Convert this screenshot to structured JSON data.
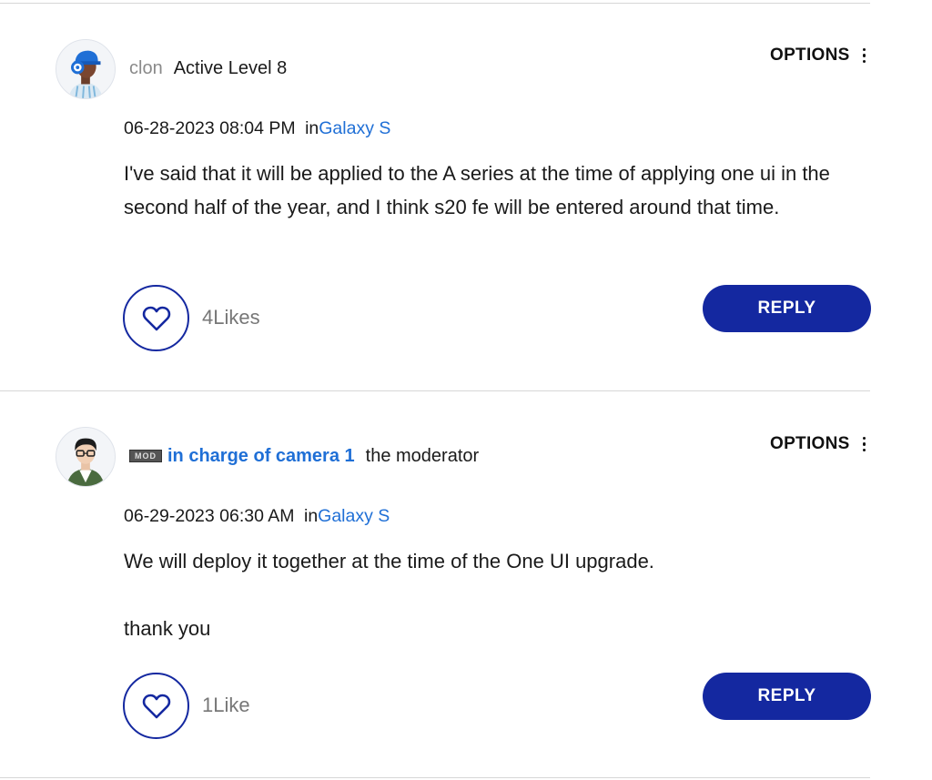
{
  "posts": [
    {
      "author": "clon",
      "rank": "Active Level 8",
      "is_moderator": false,
      "options_label": "OPTIONS",
      "date": "06-28-2023 08:04 PM",
      "in_label": "in",
      "board": "Galaxy S",
      "body": "I've said that it will be applied to the A series at the time of applying one ui in the second half of the year, and I think s20 fe will be entered around that time.",
      "likes": "4Likes",
      "reply_label": "REPLY"
    },
    {
      "mod_badge": "MOD",
      "author": "in charge of camera 1",
      "rank": "the moderator",
      "is_moderator": true,
      "options_label": "OPTIONS",
      "date": "06-29-2023 06:30 AM",
      "in_label": "in",
      "board": "Galaxy S",
      "body_lines": [
        "We will deploy it together at the time of the One UI upgrade.",
        "thank you"
      ],
      "likes": "1Like",
      "reply_label": "REPLY"
    }
  ],
  "colors": {
    "accent": "#1428a0",
    "link": "#1f6fd6",
    "divider": "#d6d6d6"
  },
  "icons": {
    "like": "heart-icon",
    "options": "kebab-menu-icon"
  }
}
